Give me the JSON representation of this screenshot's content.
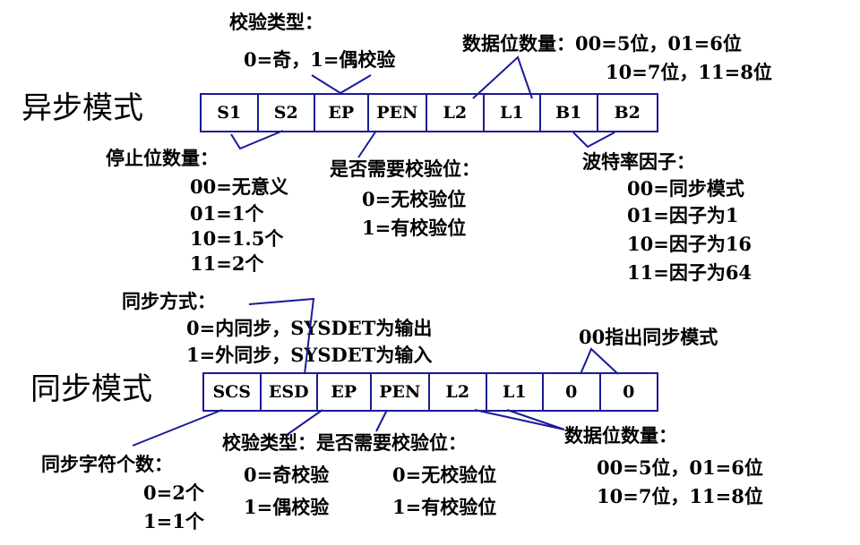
{
  "async": {
    "title": "异步模式",
    "fields": [
      "S1",
      "S2",
      "EP",
      "PEN",
      "L2",
      "L1",
      "B1",
      "B2"
    ],
    "parity_type": {
      "heading": "校验类型：",
      "line1": "0=奇，1=偶校验"
    },
    "data_bits": {
      "heading": "数据位数量：00=5位，01=6位",
      "line2": "10=7位，11=8位"
    },
    "stop_bits": {
      "heading": "停止位数量：",
      "items": [
        "00=无意义",
        "01=1个",
        "10=1.5个",
        "11=2个"
      ]
    },
    "parity_enable": {
      "heading": "是否需要校验位：",
      "items": [
        "0=无校验位",
        "1=有校验位"
      ]
    },
    "baud_factor": {
      "heading": "波特率因子：",
      "items": [
        "00=同步模式",
        "01=因子为1",
        "10=因子为16",
        "11=因子为64"
      ]
    }
  },
  "sync": {
    "title": "同步模式",
    "fields": [
      "SCS",
      "ESD",
      "EP",
      "PEN",
      "L2",
      "L1",
      "0",
      "0"
    ],
    "sync_method": {
      "heading": "同步方式：",
      "items": [
        "0=内同步，SYSDET为输出",
        "1=外同步，SYSDET为输入"
      ]
    },
    "zeros_note": "00指出同步模式",
    "sync_chars": {
      "heading": "同步字符个数：",
      "items": [
        "0=2个",
        "1=1个"
      ]
    },
    "parity": {
      "heading": "校验类型：是否需要校验位：",
      "type_items": [
        "0=奇校验",
        "1=偶校验"
      ],
      "enable_items": [
        "0=无校验位",
        "1=有校验位"
      ]
    },
    "data_bits": {
      "heading": "数据位数量：",
      "line1": "00=5位，01=6位",
      "line2": "10=7位，11=8位"
    }
  }
}
